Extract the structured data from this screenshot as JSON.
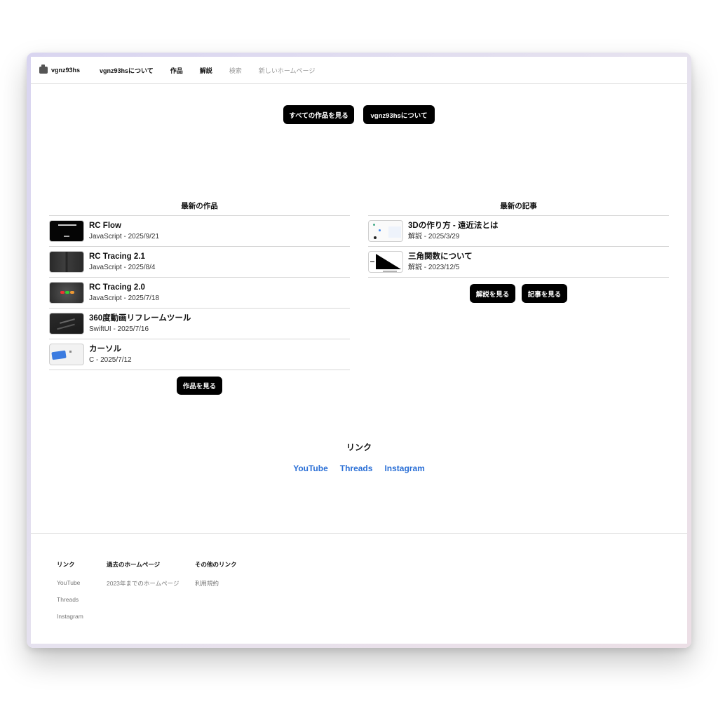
{
  "nav": {
    "brand": "vgnz93hs",
    "items": [
      "vgnz93hsについて",
      "作品",
      "解説",
      "検索",
      "新しいホームページ"
    ]
  },
  "hero": {
    "all_works_button": "すべての作品を見る",
    "about_button": "vgnz93hsについて"
  },
  "latest_works": {
    "title": "最新の作品",
    "items": [
      {
        "title": "RC Flow",
        "sub": "JavaScript - 2025/9/21"
      },
      {
        "title": "RC Tracing 2.1",
        "sub": "JavaScript - 2025/8/4"
      },
      {
        "title": "RC Tracing 2.0",
        "sub": "JavaScript - 2025/7/18"
      },
      {
        "title": "360度動画リフレームツール",
        "sub": "SwiftUI - 2025/7/16"
      },
      {
        "title": "カーソル",
        "sub": "C - 2025/7/12"
      }
    ],
    "button": "作品を見る"
  },
  "latest_articles": {
    "title": "最新の記事",
    "items": [
      {
        "title": "3Dの作り方 - 遠近法とは",
        "sub": "解説 - 2025/3/29"
      },
      {
        "title": "三角関数について",
        "sub": "解説 - 2023/12/5"
      }
    ],
    "explain_button": "解説を見る",
    "articles_button": "記事を見る"
  },
  "links": {
    "title": "リンク",
    "items": [
      "YouTube",
      "Threads",
      "Instagram"
    ]
  },
  "footer": {
    "col1": {
      "heading": "リンク",
      "items": [
        "YouTube",
        "Threads",
        "Instagram"
      ]
    },
    "col2": {
      "heading": "過去のホームページ",
      "items": [
        "2023年までのホームページ"
      ]
    },
    "col3": {
      "heading": "その他のリンク",
      "items": [
        "利用規約"
      ]
    }
  }
}
